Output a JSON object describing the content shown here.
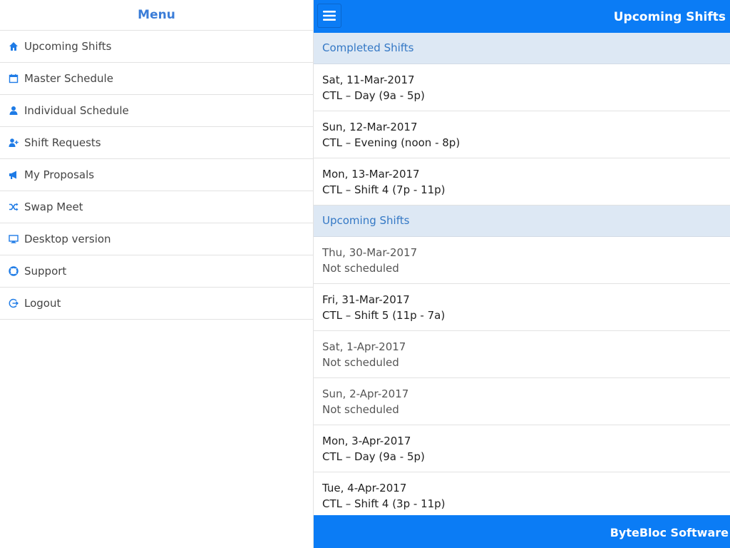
{
  "colors": {
    "primary": "#0b7cf5",
    "menu_accent": "#3b7dd8",
    "section_bg": "#dde8f4",
    "section_text": "#3478c5"
  },
  "sidebar": {
    "title": "Menu",
    "items": [
      {
        "label": "Upcoming Shifts",
        "icon": "home-icon"
      },
      {
        "label": "Master Schedule",
        "icon": "calendar-icon"
      },
      {
        "label": "Individual Schedule",
        "icon": "user-icon"
      },
      {
        "label": "Shift Requests",
        "icon": "user-add-icon"
      },
      {
        "label": "My Proposals",
        "icon": "megaphone-icon"
      },
      {
        "label": "Swap Meet",
        "icon": "shuffle-icon"
      },
      {
        "label": "Desktop version",
        "icon": "monitor-icon"
      },
      {
        "label": "Support",
        "icon": "lifebuoy-icon"
      },
      {
        "label": "Logout",
        "icon": "logout-icon"
      }
    ]
  },
  "header": {
    "title": "Upcoming Shifts",
    "menu_button_icon": "hamburger-icon"
  },
  "completed": {
    "heading": "Completed Shifts",
    "shifts": [
      {
        "date": "Sat, 11-Mar-2017",
        "detail": "CTL – Day (9a - 5p)"
      },
      {
        "date": "Sun, 12-Mar-2017",
        "detail": "CTL – Evening (noon - 8p)"
      },
      {
        "date": "Mon, 13-Mar-2017",
        "detail": "CTL – Shift 4 (7p - 11p)"
      }
    ]
  },
  "upcoming": {
    "heading": "Upcoming Shifts",
    "shifts": [
      {
        "date": "Thu, 30-Mar-2017",
        "detail": "Not scheduled"
      },
      {
        "date": "Fri, 31-Mar-2017",
        "detail": "CTL – Shift 5 (11p - 7a)"
      },
      {
        "date": "Sat, 1-Apr-2017",
        "detail": "Not scheduled"
      },
      {
        "date": "Sun, 2-Apr-2017",
        "detail": "Not scheduled"
      },
      {
        "date": "Mon, 3-Apr-2017",
        "detail": "CTL – Day (9a - 5p)"
      },
      {
        "date": "Tue, 4-Apr-2017",
        "detail": "CTL – Shift 4 (3p - 11p)"
      }
    ]
  },
  "footer": {
    "text": "ByteBloc Software"
  }
}
